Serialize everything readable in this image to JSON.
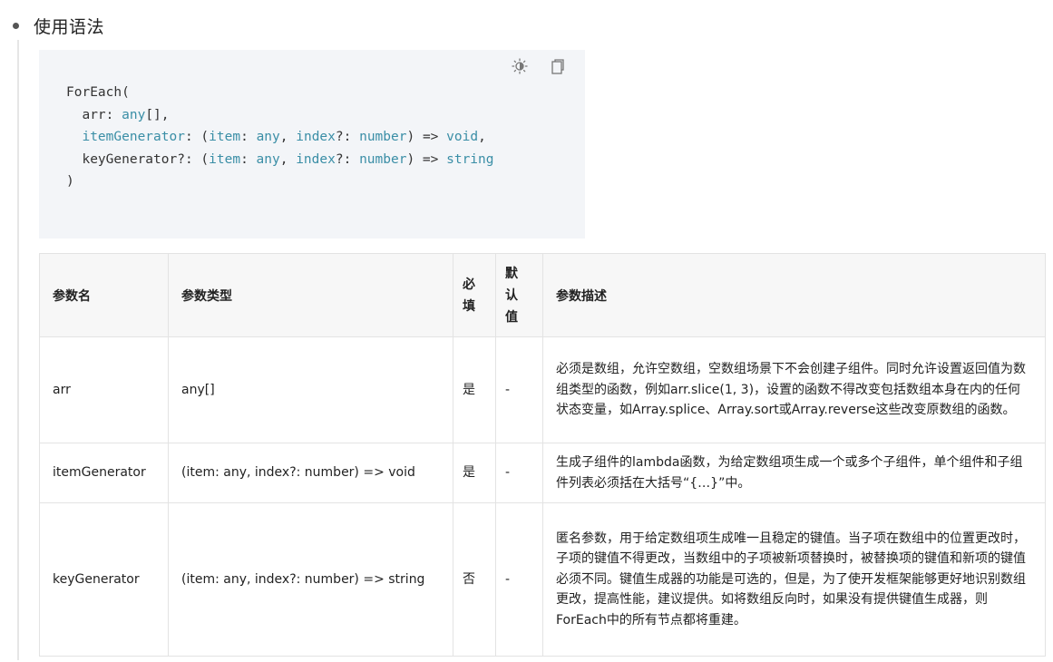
{
  "section": {
    "bullet_title": "使用语法"
  },
  "code": {
    "toolbar": {
      "theme_icon": "theme-toggle-icon",
      "copy_icon": "copy-icon"
    },
    "lines": [
      {
        "parts": [
          {
            "t": "ForEach(",
            "k": false
          }
        ]
      },
      {
        "parts": [
          {
            "t": "  arr: ",
            "k": false
          },
          {
            "t": "any",
            "k": true
          },
          {
            "t": "[],",
            "k": false
          }
        ]
      },
      {
        "parts": [
          {
            "t": "  ",
            "k": false
          },
          {
            "t": "itemGenerator",
            "k": true
          },
          {
            "t": ": (",
            "k": false
          },
          {
            "t": "item",
            "k": true
          },
          {
            "t": ": ",
            "k": false
          },
          {
            "t": "any",
            "k": true
          },
          {
            "t": ", ",
            "k": false
          },
          {
            "t": "index",
            "k": true
          },
          {
            "t": "?: ",
            "k": false
          },
          {
            "t": "number",
            "k": true
          },
          {
            "t": ") => ",
            "k": false
          },
          {
            "t": "void",
            "k": true
          },
          {
            "t": ",",
            "k": false
          }
        ]
      },
      {
        "parts": [
          {
            "t": "  keyGenerator?: (",
            "k": false
          },
          {
            "t": "item",
            "k": true
          },
          {
            "t": ": ",
            "k": false
          },
          {
            "t": "any",
            "k": true
          },
          {
            "t": ", ",
            "k": false
          },
          {
            "t": "index",
            "k": true
          },
          {
            "t": "?: ",
            "k": false
          },
          {
            "t": "number",
            "k": true
          },
          {
            "t": ") => ",
            "k": false
          },
          {
            "t": "string",
            "k": true
          }
        ]
      },
      {
        "parts": [
          {
            "t": ")",
            "k": false
          }
        ]
      }
    ]
  },
  "table": {
    "headers": {
      "name": "参数名",
      "type": "参数类型",
      "required": [
        "必",
        "填"
      ],
      "default": [
        "默",
        "认",
        "值"
      ],
      "desc": "参数描述"
    },
    "rows": [
      {
        "name": "arr",
        "type": "any[]",
        "required": "是",
        "default": "-",
        "desc": "必须是数组，允许空数组，空数组场景下不会创建子组件。同时允许设置返回值为数组类型的函数，例如arr.slice(1, 3)，设置的函数不得改变包括数组本身在内的任何状态变量，如Array.splice、Array.sort或Array.reverse这些改变原数组的函数。"
      },
      {
        "name": "itemGenerator",
        "type": "(item: any, index?: number) => void",
        "required": "是",
        "default": "-",
        "desc": "生成子组件的lambda函数，为给定数组项生成一个或多个子组件，单个组件和子组件列表必须括在大括号“{…}”中。"
      },
      {
        "name": "keyGenerator",
        "type": "(item: any, index?: number) => string",
        "required": "否",
        "default": "-",
        "desc": "匿名参数，用于给定数组项生成唯一且稳定的键值。当子项在数组中的位置更改时，子项的键值不得更改，当数组中的子项被新项替换时，被替换项的键值和新项的键值必须不同。键值生成器的功能是可选的，但是，为了使开发框架能够更好地识别数组更改，提高性能，建议提供。如将数组反向时，如果没有提供键值生成器，则ForEach中的所有节点都将重建。"
      }
    ]
  }
}
